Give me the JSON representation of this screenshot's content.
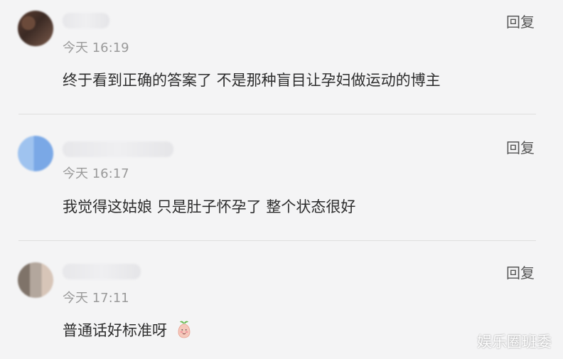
{
  "comments": [
    {
      "timestamp": "今天 16:19",
      "reply_label": "回复",
      "text": "终于看到正确的答案了 不是那种盲目让孕妇做运动的博主"
    },
    {
      "timestamp": "今天 16:17",
      "reply_label": "回复",
      "text": "我觉得这姑娘 只是肚子怀孕了 整个状态很好"
    },
    {
      "timestamp": "今天 17:11",
      "reply_label": "回复",
      "text": "普通话好标准呀"
    }
  ],
  "watermark": {
    "text": "娱乐圈班委"
  },
  "icons": {
    "emoji": "blushing-radish-emoji"
  }
}
